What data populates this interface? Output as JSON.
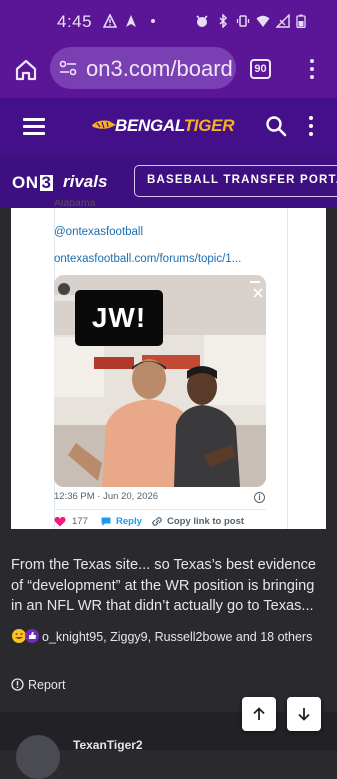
{
  "status_bar": {
    "time": "4:45"
  },
  "browser": {
    "url": "on3.com/board",
    "tab_count": "90"
  },
  "site": {
    "logo_bengal": "BENGAL",
    "logo_tiger": "TIGER"
  },
  "sub_nav": {
    "on3_prefix": "ON",
    "on3_suffix": "3",
    "rivals": "rivals",
    "topic_button": "BASEBALL TRANSFER PORTAL"
  },
  "embed": {
    "partial_top_text": "Alabama",
    "handle": "@ontexasfootball",
    "link": "ontexasfootball.com/forums/topic/1...",
    "photo_caption": "JW!",
    "timestamp": "12:36 PM · Jun 20, 2026",
    "likes": "177",
    "reply": "Reply",
    "copy_link": "Copy link to post"
  },
  "post": {
    "body": "From the Texas site... so Texas’s best evidence of “development” at the WR position is bringing in an NFL WR that didn’t actually go to Texas...",
    "reactions_text": "o_knight95, Ziggy9, Russell2bowe and 18 others",
    "report_label": "Report"
  },
  "next_post": {
    "username": "TexanTiger2"
  },
  "colors": {
    "status_bar": "#5a1696",
    "site_header": "#43108a",
    "sub_nav": "#3e0f80",
    "tiger_gold": "#f5b021",
    "content_bg": "#2a2a2e",
    "link_blue": "#1b6fb3",
    "like_pink": "#f91880"
  }
}
